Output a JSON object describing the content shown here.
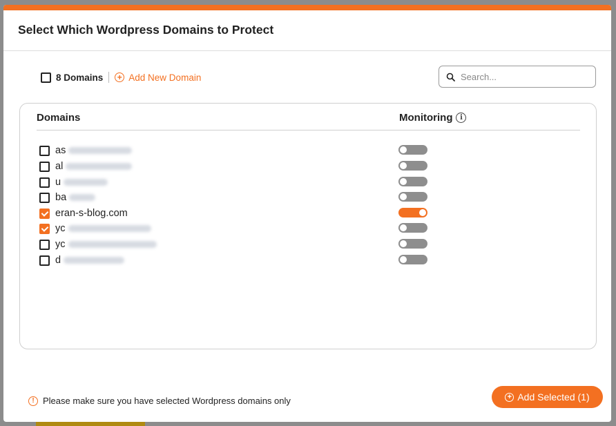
{
  "modal": {
    "title": "Select Which Wordpress Domains to Protect",
    "accent_color": "#f37021"
  },
  "toolbar": {
    "select_all_checked": false,
    "domains_count": "8 Domains",
    "add_new_domain": "Add New Domain",
    "add_icon": "plus-circle-icon"
  },
  "search": {
    "placeholder": "Search...",
    "value": "",
    "icon": "search-icon"
  },
  "list": {
    "columns": {
      "domains": "Domains",
      "monitoring": "Monitoring"
    },
    "rows": [
      {
        "label": "as",
        "checked": false,
        "monitoring": false,
        "blurred": true
      },
      {
        "label": "al",
        "checked": false,
        "monitoring": false,
        "blurred": true
      },
      {
        "label": "u",
        "checked": false,
        "monitoring": false,
        "blurred": true
      },
      {
        "label": "ba",
        "checked": false,
        "monitoring": false,
        "blurred": true
      },
      {
        "label": "eran-s-blog.com",
        "checked": true,
        "monitoring": true,
        "blurred": false
      },
      {
        "label": "yc",
        "checked": true,
        "monitoring": false,
        "blurred": true
      },
      {
        "label": "yc",
        "checked": false,
        "monitoring": false,
        "blurred": true
      },
      {
        "label": "d",
        "checked": false,
        "monitoring": false,
        "blurred": true
      }
    ]
  },
  "footer": {
    "warning": "Please make sure you have selected Wordpress domains only",
    "warning_icon": "alert-circle-icon",
    "add_selected": "Add Selected (1)"
  }
}
